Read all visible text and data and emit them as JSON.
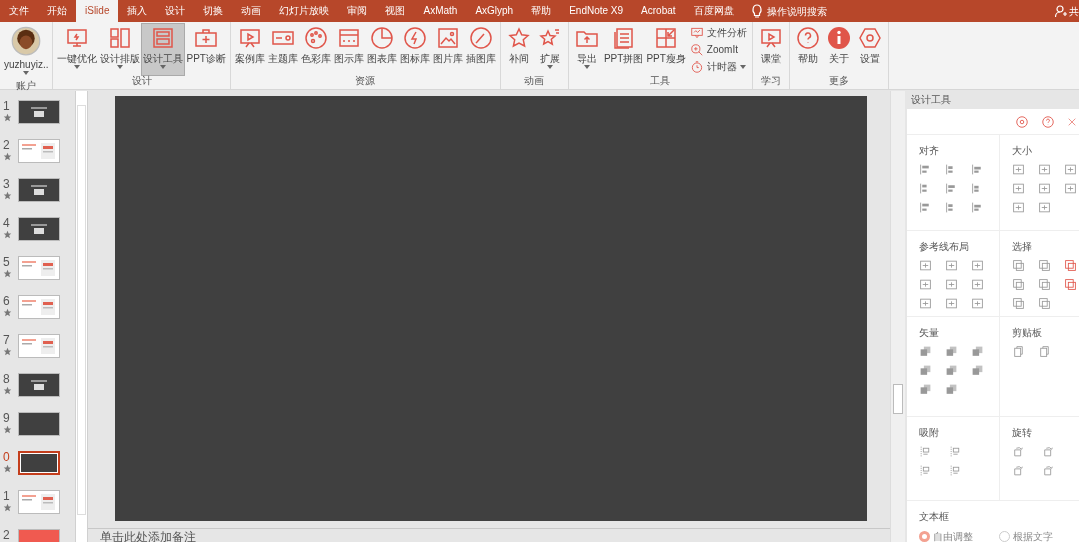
{
  "menu_tabs": [
    {
      "label": "文件",
      "selected": false
    },
    {
      "label": "开始",
      "selected": false
    },
    {
      "label": "iSlide",
      "selected": true
    },
    {
      "label": "插入",
      "selected": false
    },
    {
      "label": "设计",
      "selected": false
    },
    {
      "label": "切换",
      "selected": false
    },
    {
      "label": "动画",
      "selected": false
    },
    {
      "label": "幻灯片放映",
      "selected": false
    },
    {
      "label": "审阅",
      "selected": false
    },
    {
      "label": "视图",
      "selected": false
    },
    {
      "label": "AxMath",
      "selected": false
    },
    {
      "label": "AxGlyph",
      "selected": false
    },
    {
      "label": "帮助",
      "selected": false
    },
    {
      "label": "EndNote X9",
      "selected": false
    },
    {
      "label": "Acrobat",
      "selected": false
    },
    {
      "label": "百度网盘",
      "selected": false
    }
  ],
  "tell_me": "操作说明搜索",
  "share": "共",
  "ribbon_groups": [
    {
      "label": "账户",
      "items": [
        {
          "label": "yuzhuyiz..",
          "kind": "account",
          "dropdown": true,
          "selected": false
        }
      ]
    },
    {
      "label": "设计",
      "items": [
        {
          "label": "一键优化",
          "kind": "large",
          "dropdown": true,
          "selected": false
        },
        {
          "label": "设计排版",
          "kind": "large",
          "dropdown": true,
          "selected": false
        },
        {
          "label": "设计工具",
          "kind": "large",
          "dropdown": true,
          "selected": true
        },
        {
          "label": "PPT诊断",
          "kind": "large",
          "dropdown": false,
          "selected": false
        }
      ]
    },
    {
      "label": "资源",
      "items": [
        {
          "label": "案例库",
          "kind": "large",
          "dropdown": false,
          "selected": false
        },
        {
          "label": "主题库",
          "kind": "large",
          "dropdown": false,
          "selected": false
        },
        {
          "label": "色彩库",
          "kind": "large",
          "dropdown": false,
          "selected": false
        },
        {
          "label": "图示库",
          "kind": "large",
          "dropdown": false,
          "selected": false
        },
        {
          "label": "图表库",
          "kind": "large",
          "dropdown": false,
          "selected": false
        },
        {
          "label": "图标库",
          "kind": "large",
          "dropdown": false,
          "selected": false
        },
        {
          "label": "图片库",
          "kind": "large",
          "dropdown": false,
          "selected": false
        },
        {
          "label": "插图库",
          "kind": "large",
          "dropdown": false,
          "selected": false
        }
      ]
    },
    {
      "label": "动画",
      "items": [
        {
          "label": "补间",
          "kind": "large",
          "dropdown": false,
          "selected": false
        },
        {
          "label": "扩展",
          "kind": "large",
          "dropdown": true,
          "selected": false
        }
      ]
    },
    {
      "label": "工具",
      "items": [
        {
          "label": "导出",
          "kind": "large",
          "dropdown": true,
          "selected": false
        },
        {
          "label": "PPT拼图",
          "kind": "large",
          "dropdown": false,
          "selected": false
        },
        {
          "label": "PPT瘦身",
          "kind": "large",
          "dropdown": false,
          "selected": false
        },
        {
          "label": "文件分析",
          "kind": "small",
          "dropdown": false,
          "selected": false
        },
        {
          "label": "ZoomIt",
          "kind": "small",
          "dropdown": false,
          "selected": false
        },
        {
          "label": "计时器",
          "kind": "small",
          "dropdown": true,
          "selected": false
        }
      ]
    },
    {
      "label": "学习",
      "items": [
        {
          "label": "课堂",
          "kind": "large",
          "dropdown": false,
          "selected": false
        }
      ]
    },
    {
      "label": "更多",
      "items": [
        {
          "label": "帮助",
          "kind": "large",
          "dropdown": false,
          "selected": false
        },
        {
          "label": "关于",
          "kind": "large",
          "dropdown": false,
          "selected": false
        },
        {
          "label": "设置",
          "kind": "large",
          "dropdown": false,
          "selected": false
        }
      ]
    }
  ],
  "slides": [
    {
      "number": "1",
      "kind": "dark",
      "selected": false
    },
    {
      "number": "2",
      "kind": "light",
      "selected": false
    },
    {
      "number": "3",
      "kind": "dark",
      "selected": false
    },
    {
      "number": "4",
      "kind": "dark",
      "selected": false
    },
    {
      "number": "5",
      "kind": "light",
      "selected": false
    },
    {
      "number": "6",
      "kind": "light",
      "selected": false
    },
    {
      "number": "7",
      "kind": "light",
      "selected": false
    },
    {
      "number": "8",
      "kind": "dark",
      "selected": false
    },
    {
      "number": "9",
      "kind": "dark",
      "selected": false
    },
    {
      "number": "0",
      "kind": "dark",
      "selected": true
    },
    {
      "number": "1",
      "kind": "light",
      "selected": false
    },
    {
      "number": "2",
      "kind": "red",
      "selected": false
    }
  ],
  "design_panel": {
    "title": "设计工具",
    "sections": [
      {
        "title": "对齐"
      },
      {
        "title": "大小"
      },
      {
        "title": "参考线布局"
      },
      {
        "title": "选择"
      },
      {
        "title": "矢量"
      },
      {
        "title": "剪贴板"
      },
      {
        "title": "吸附"
      },
      {
        "title": "旋转"
      }
    ],
    "textbox": {
      "title": "文本框",
      "options": [
        {
          "label": "自由调整",
          "selected": true
        },
        {
          "label": "根据文字",
          "selected": false
        }
      ]
    }
  },
  "notes": {
    "placeholder": "单击此处添加备注"
  }
}
